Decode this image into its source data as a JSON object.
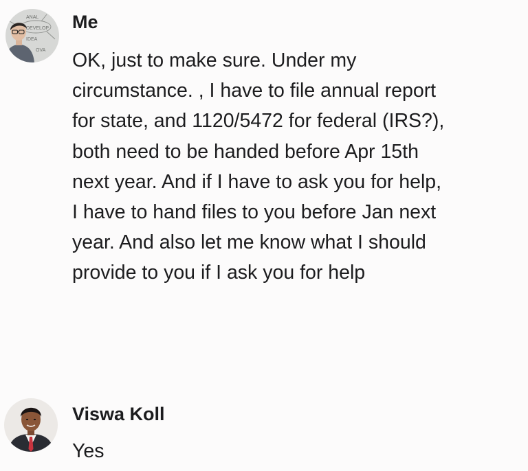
{
  "messages": [
    {
      "sender": "Me",
      "avatar_icon": "user-avatar",
      "avatar_lettering": [
        "ANAL",
        "DEVELOP",
        "IDEA",
        "OVA"
      ],
      "text": "OK, just to make sure. Under my\ncircumstance.   , I have to file annual report\nfor state, and 1120/5472 for federal (IRS?),\nboth need to be handed before Apr 15th\nnext year. And if I have to ask you for help,\nI have to hand files to you before Jan next\nyear. And also let me know what I should\nprovide to you if I ask you for help"
    },
    {
      "sender": "Viswa Koll",
      "avatar_icon": "contact-avatar",
      "text": "Yes"
    }
  ],
  "colors": {
    "background": "#fcfbfb",
    "text": "#1c1c1e",
    "suit": "#2a2c33",
    "tie": "#c8343f"
  }
}
